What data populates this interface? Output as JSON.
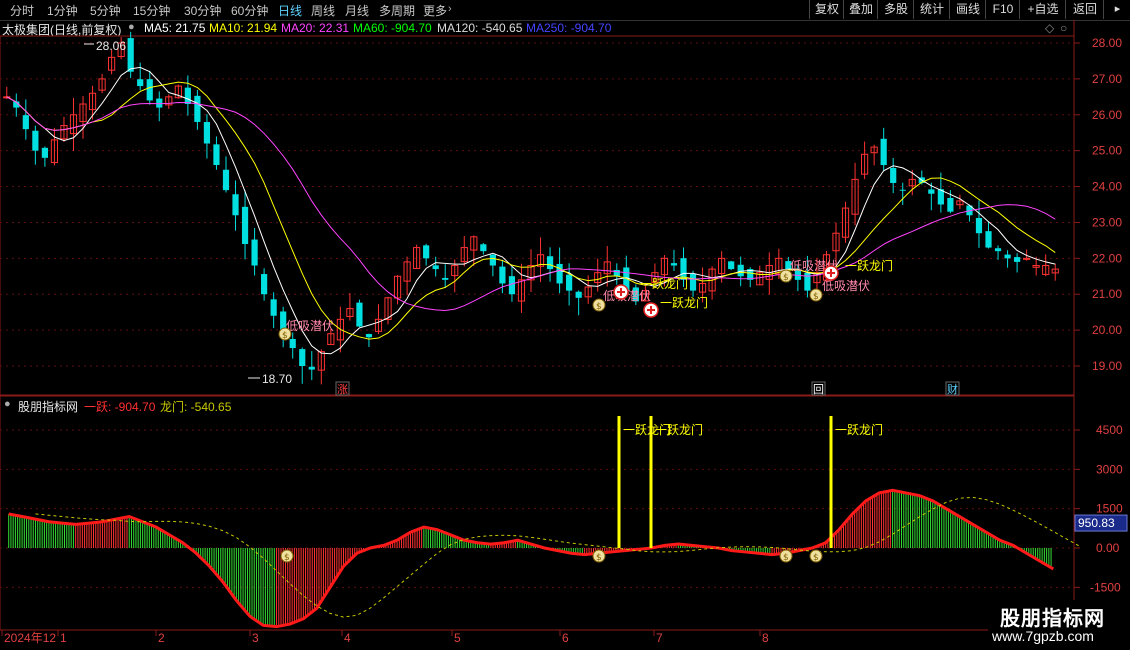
{
  "toolbar": {
    "periods": [
      "分时",
      "1分钟",
      "5分钟",
      "15分钟",
      "30分钟",
      "60分钟",
      "日线",
      "周线",
      "月线",
      "多周期",
      "更多"
    ],
    "active_period": "日线",
    "right_buttons": [
      "复权",
      "叠加",
      "多股",
      "统计",
      "画线",
      "F10",
      "+自选",
      "返回"
    ]
  },
  "main_chart": {
    "stock_title": "太极集团(日线,前复权)",
    "ma_legend": [
      {
        "label": "MA5: 21.75",
        "color": "#ffffff"
      },
      {
        "label": "MA10: 21.94",
        "color": "#ffff00"
      },
      {
        "label": "MA20: 22.31",
        "color": "#ff44ff"
      },
      {
        "label": "MA60: -904.70",
        "color": "#00ff00"
      },
      {
        "label": "MA120: -540.65",
        "color": "#dddddd"
      },
      {
        "label": "MA250: -904.70",
        "color": "#4444ff"
      }
    ],
    "y_ticks": [
      "28.00",
      "27.00",
      "26.00",
      "25.00",
      "24.00",
      "23.00",
      "22.00",
      "21.00",
      "20.00",
      "19.00"
    ],
    "high_label": "28.06",
    "low_label": "18.70",
    "signal_labels": {
      "dip": "低吸潜伏",
      "jump": "一跃龙门"
    },
    "event_markers": [
      "涨",
      "回",
      "财"
    ]
  },
  "indicator": {
    "name": "股朋指标网",
    "legend": [
      {
        "label": "一跃: -904.70",
        "color": "#ff3030"
      },
      {
        "label": "龙门: -540.65",
        "color": "#c8c800"
      }
    ],
    "y_ticks": [
      "4500",
      "3000",
      "1500",
      "0.00",
      "-1500"
    ],
    "current_value": "950.83",
    "jump_label": "一跃龙门"
  },
  "date_axis": [
    "2024年12",
    "1",
    "2",
    "3",
    "4",
    "5",
    "6",
    "7",
    "8"
  ],
  "watermark": {
    "title": "股朋指标网",
    "url": "www.7gpzb.com"
  },
  "chart_data": {
    "type": "candlestick",
    "price_range": [
      18.7,
      28.06
    ],
    "close_series": [
      26.5,
      26.2,
      25.6,
      25.0,
      24.8,
      25.3,
      25.7,
      26.0,
      26.3,
      26.6,
      27.0,
      27.6,
      28.0,
      27.2,
      26.8,
      26.4,
      26.2,
      26.5,
      26.8,
      26.3,
      25.8,
      25.2,
      24.6,
      23.9,
      23.2,
      22.4,
      21.8,
      21.0,
      20.4,
      20.0,
      19.5,
      19.0,
      18.9,
      19.4,
      19.9,
      20.3,
      20.6,
      20.1,
      19.8,
      20.3,
      20.9,
      21.5,
      21.9,
      22.3,
      22.0,
      21.7,
      21.4,
      21.8,
      22.3,
      22.6,
      22.2,
      21.8,
      21.3,
      21.0,
      21.4,
      21.8,
      22.1,
      21.7,
      21.3,
      21.1,
      20.9,
      21.2,
      21.6,
      21.9,
      21.5,
      21.1,
      20.8,
      21.1,
      21.6,
      22.0,
      21.8,
      21.4,
      21.1,
      21.3,
      21.7,
      22.0,
      21.7,
      21.5,
      21.4,
      21.6,
      21.8,
      22.0,
      21.7,
      21.4,
      21.1,
      21.6,
      22.1,
      22.7,
      23.4,
      24.2,
      24.9,
      25.1,
      24.6,
      24.1,
      23.9,
      24.2,
      24.1,
      23.8,
      23.5,
      23.3,
      23.6,
      23.2,
      22.7,
      22.3,
      22.2,
      22.0,
      21.9,
      22.0,
      21.8,
      21.8,
      21.7
    ],
    "indicator_series": [
      1300,
      1200,
      1100,
      1000,
      950,
      900,
      950,
      1000,
      1100,
      1200,
      1000,
      800,
      500,
      200,
      -200,
      -700,
      -1300,
      -2000,
      -2600,
      -2950,
      -3000,
      -2900,
      -2700,
      -2300,
      -1500,
      -700,
      -200,
      0,
      100,
      300,
      600,
      800,
      700,
      500,
      300,
      200,
      150,
      200,
      300,
      150,
      0,
      -100,
      -200,
      -250,
      -200,
      -150,
      -100,
      -50,
      0,
      100,
      150,
      100,
      50,
      0,
      -100,
      -150,
      -200,
      -250,
      -200,
      -100,
      0,
      200,
      700,
      1300,
      1800,
      2100,
      2200,
      2100,
      2000,
      1800,
      1500,
      1200,
      900,
      600,
      300,
      100,
      -200,
      -500,
      -800
    ]
  }
}
